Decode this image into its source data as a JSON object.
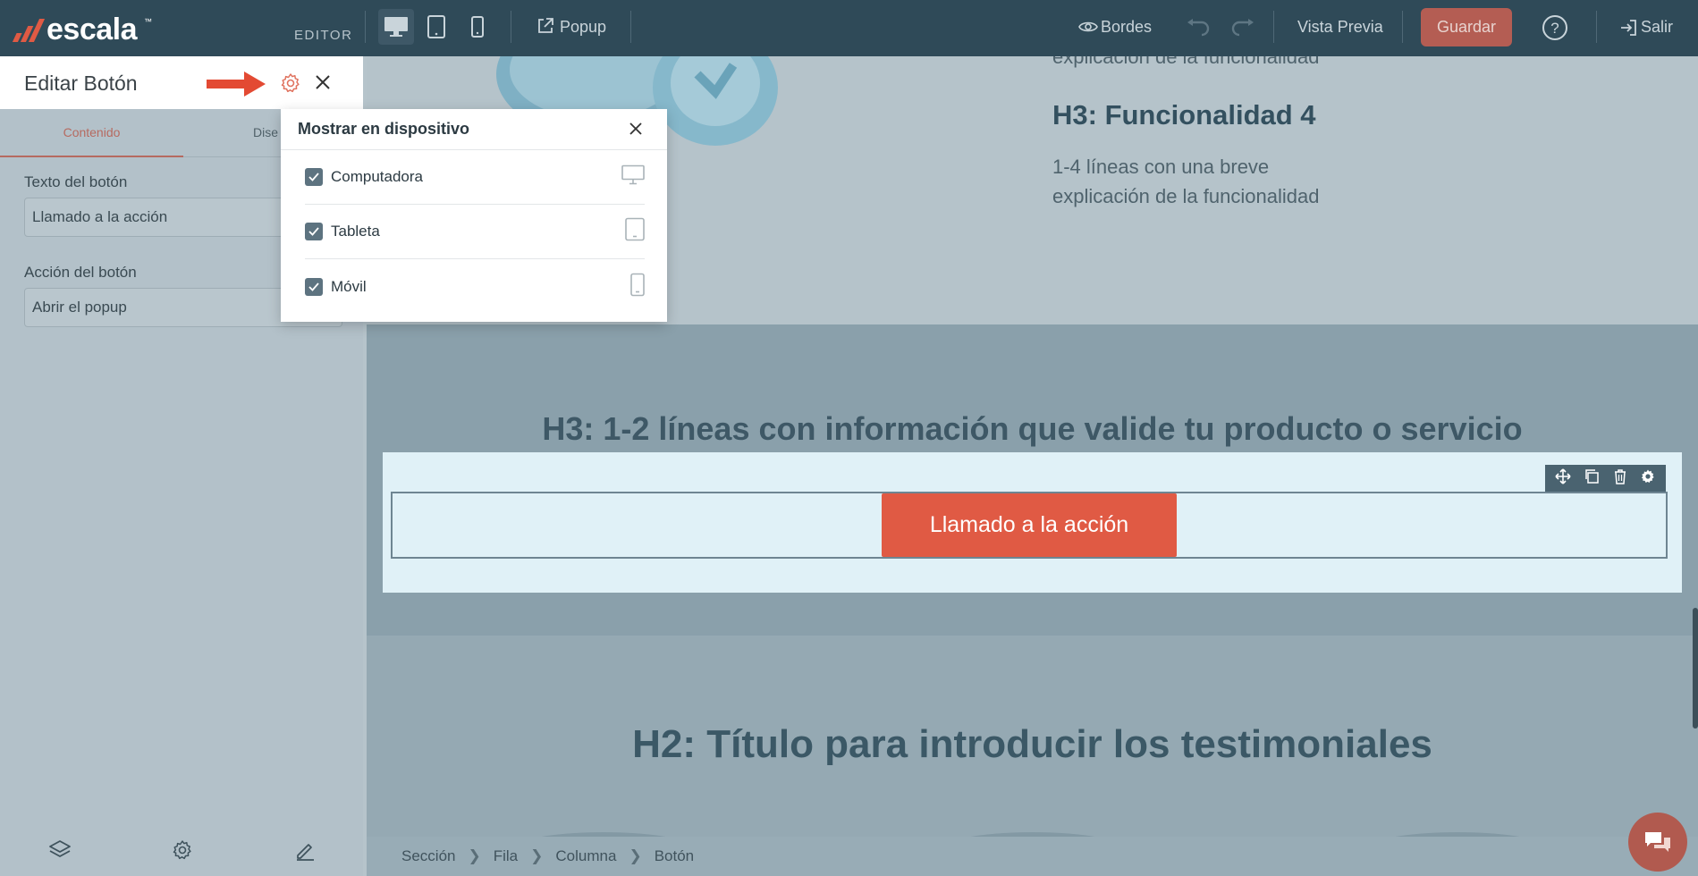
{
  "topbar": {
    "brand": "escala",
    "brand_tm": "™",
    "mode_label": "EDITOR",
    "popup_label": "Popup",
    "borders_label": "Bordes",
    "preview_label": "Vista Previa",
    "save_label": "Guardar",
    "exit_label": "Salir",
    "active_device": "desktop"
  },
  "panel": {
    "title": "Editar Botón",
    "tabs": [
      {
        "label": "Contenido",
        "active": true
      },
      {
        "label": "Dise",
        "active": false
      }
    ],
    "fields": [
      {
        "label": "Texto del botón",
        "value": "Llamado a la acción"
      },
      {
        "label": "Acción del botón",
        "value": "Abrir el popup"
      }
    ]
  },
  "popover": {
    "title": "Mostrar en dispositivo",
    "options": [
      {
        "label": "Computadora",
        "checked": true,
        "icon": "desktop-icon"
      },
      {
        "label": "Tableta",
        "checked": true,
        "icon": "tablet-icon"
      },
      {
        "label": "Móvil",
        "checked": true,
        "icon": "mobile-icon"
      }
    ]
  },
  "canvas": {
    "feature_top_text": "explicación de la funcionalidad",
    "feature_heading": "H3: Funcionalidad 4",
    "feature_line1": "1-4 líneas con una breve",
    "feature_line2": "explicación de la funcionalidad",
    "validation_heading": "H3: 1-2 líneas con información que valide tu producto o servicio",
    "cta_label": "Llamado a la acción",
    "testimonials_heading": "H2: Título para introducir los testimoniales"
  },
  "breadcrumb": [
    "Sección",
    "Fila",
    "Columna",
    "Botón"
  ],
  "colors": {
    "accent": "#e05a44",
    "topbar": "#2f4a58",
    "save_button": "#b45d53"
  }
}
